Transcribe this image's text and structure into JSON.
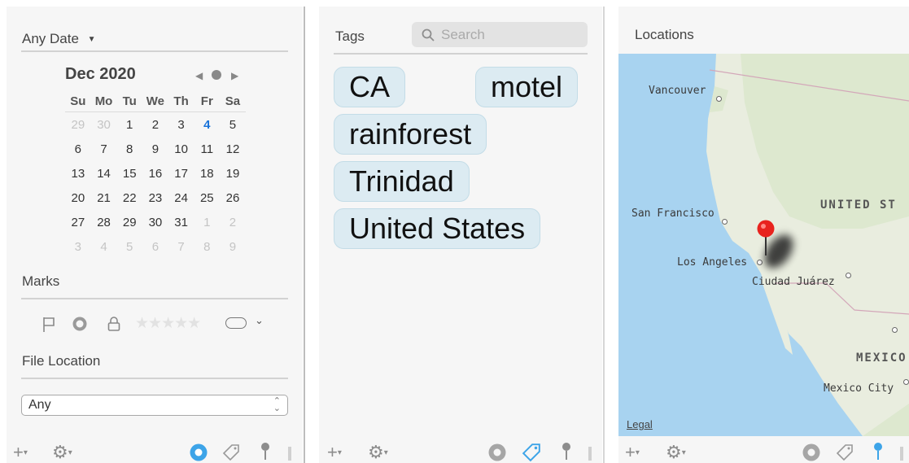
{
  "left_panel": {
    "date_filter": "Any Date",
    "calendar": {
      "month_title": "Dec 2020",
      "weekdays": [
        "Su",
        "Mo",
        "Tu",
        "We",
        "Th",
        "Fr",
        "Sa"
      ],
      "weeks": [
        [
          "29",
          "30",
          "1",
          "2",
          "3",
          "4",
          "5"
        ],
        [
          "6",
          "7",
          "8",
          "9",
          "10",
          "11",
          "12"
        ],
        [
          "13",
          "14",
          "15",
          "16",
          "17",
          "18",
          "19"
        ],
        [
          "20",
          "21",
          "22",
          "23",
          "24",
          "25",
          "26"
        ],
        [
          "27",
          "28",
          "29",
          "30",
          "31",
          "1",
          "2"
        ],
        [
          "3",
          "4",
          "5",
          "6",
          "7",
          "8",
          "9"
        ]
      ],
      "today": "4"
    },
    "marks_title": "Marks",
    "rating_stars": "★★★★★",
    "file_location_title": "File Location",
    "file_location_value": "Any"
  },
  "tags_panel": {
    "title": "Tags",
    "search_placeholder": "Search",
    "tags": [
      "CA",
      "motel",
      "rainforest",
      "Trinidad",
      "United States"
    ]
  },
  "locations_panel": {
    "title": "Locations",
    "cities": [
      "Vancouver",
      "San Francisco",
      "Los Angeles",
      "Ciudad Juárez",
      "Mexico City"
    ],
    "countries": [
      "UNITED ST",
      "MEXICO"
    ],
    "legal_link": "Legal"
  },
  "colors": {
    "accent": "#3da4e8",
    "today": "#1a73d9",
    "pin": "#e8231e",
    "tag_bg": "#dcebf2",
    "water": "#a8d3f0"
  }
}
